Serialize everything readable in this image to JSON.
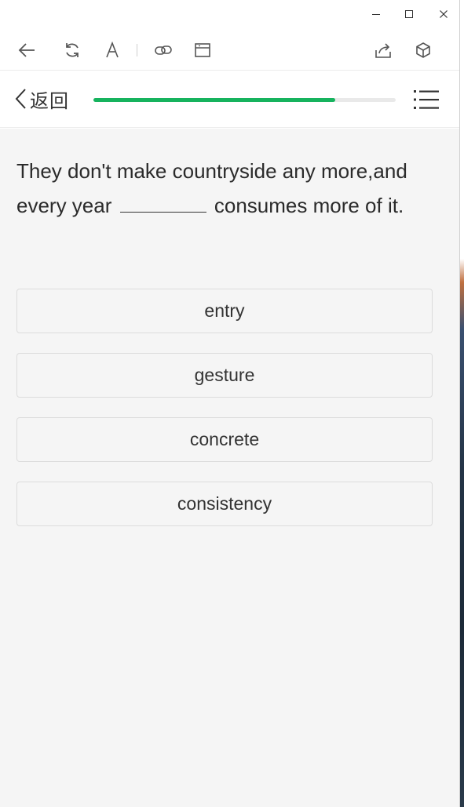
{
  "window_controls": {
    "minimize_icon": "minimize-icon",
    "maximize_icon": "maximize-icon",
    "close_icon": "close-icon"
  },
  "toolbar": {
    "icons": [
      "back-arrow-icon",
      "refresh-icon",
      "font-icon",
      "link-icon",
      "window-icon",
      "share-icon",
      "cube-icon"
    ]
  },
  "header": {
    "back_label": "返回",
    "progress": 0.8
  },
  "question": {
    "text_before": "They don't make countryside any more,and every year",
    "text_after": "consumes more of it."
  },
  "options": [
    {
      "label": "entry"
    },
    {
      "label": "gesture"
    },
    {
      "label": "concrete"
    },
    {
      "label": "consistency"
    }
  ],
  "colors": {
    "accent": "#16b35e",
    "background": "#f5f5f5"
  }
}
